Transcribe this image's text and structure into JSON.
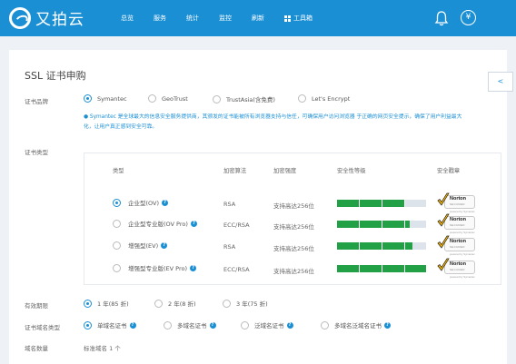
{
  "brand": {
    "name": "又拍云"
  },
  "nav": {
    "items": [
      {
        "label": "总览"
      },
      {
        "label": "服务"
      },
      {
        "label": "统计"
      },
      {
        "label": "监控"
      },
      {
        "label": "刷新"
      },
      {
        "label": "工具箱"
      }
    ]
  },
  "header_icons": {
    "bell": "bell-icon",
    "yen": "¥"
  },
  "side_button": {
    "label": "<"
  },
  "page": {
    "title": "SSL 证书申购"
  },
  "brand_section": {
    "label": "证书品牌",
    "options": [
      {
        "label": "Symantec",
        "selected": true
      },
      {
        "label": "GeoTrust",
        "selected": false
      },
      {
        "label": "TrustAsia(含免费)",
        "selected": false
      },
      {
        "label": "Let's Encrypt",
        "selected": false
      }
    ],
    "description": "Symantec 是全球最大的信息安全服务提供商，其颁发的证书能被所有浏览器支持与信任，可确保用户访问浏览器 于正确的网页安全提示，确保了用户利益最大化，让用户真正感到安全可靠。"
  },
  "type_section": {
    "label": "证书类型",
    "headers": {
      "type": "类型",
      "algorithm": "加密算法",
      "strength": "加密强度",
      "security": "安全性等级",
      "seal": "安全戳章"
    },
    "rows": [
      {
        "name": "企业型(OV)",
        "selected": true,
        "algorithm": "RSA",
        "strength": "支持高达256位",
        "security_level": 0.75
      },
      {
        "name": "企业型专业版(OV Pro)",
        "selected": false,
        "algorithm": "ECC/RSA",
        "strength": "支持高达256位",
        "security_level": 0.82
      },
      {
        "name": "增强型(EV)",
        "selected": false,
        "algorithm": "RSA",
        "strength": "支持高达256位",
        "security_level": 0.85
      },
      {
        "name": "增强型专业版(EV Pro)",
        "selected": false,
        "algorithm": "ECC/RSA",
        "strength": "支持高达256位",
        "security_level": 1.0
      }
    ],
    "seal": {
      "name": "Norton",
      "sub": "SECURED",
      "powered": "powered by Symantec"
    }
  },
  "period_section": {
    "label": "有效期限",
    "options": [
      {
        "label": "1 年(85 折)",
        "selected": true
      },
      {
        "label": "2 年(8 折)",
        "selected": false
      },
      {
        "label": "3 年(75 折)",
        "selected": false
      }
    ]
  },
  "domain_type_section": {
    "label": "证书域名类型",
    "options": [
      {
        "label": "单域名证书",
        "selected": true
      },
      {
        "label": "多域名证书",
        "selected": false
      },
      {
        "label": "泛域名证书",
        "selected": false
      },
      {
        "label": "多域名泛域名证书",
        "selected": false
      }
    ]
  },
  "domain_count_section": {
    "label": "域名数量",
    "value": "标准域名 1 个"
  }
}
